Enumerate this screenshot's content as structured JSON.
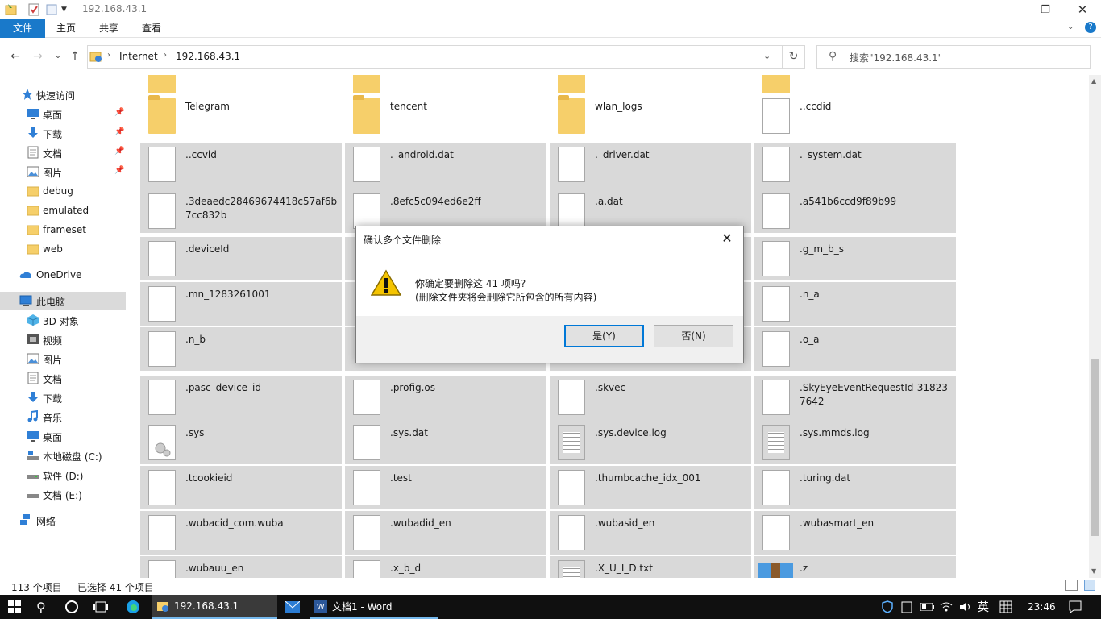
{
  "window": {
    "title": "192.168.43.1"
  },
  "ribbon": {
    "tabs": [
      "文件",
      "主页",
      "共享",
      "查看"
    ]
  },
  "address": {
    "crumbs": [
      "Internet",
      "192.168.43.1"
    ],
    "search_placeholder": "搜索\"192.168.43.1\""
  },
  "nav": {
    "quick_access": "快速访问",
    "items": [
      {
        "label": "桌面",
        "icon": "desktop-icon",
        "pinned": true
      },
      {
        "label": "下载",
        "icon": "download-icon",
        "pinned": true
      },
      {
        "label": "文档",
        "icon": "document-icon",
        "pinned": true
      },
      {
        "label": "图片",
        "icon": "picture-icon",
        "pinned": true
      },
      {
        "label": "debug",
        "icon": "folder-icon",
        "pinned": false
      },
      {
        "label": "emulated",
        "icon": "folder-icon",
        "pinned": false
      },
      {
        "label": "frameset",
        "icon": "folder-icon",
        "pinned": false
      },
      {
        "label": "web",
        "icon": "folder-icon",
        "pinned": false
      }
    ],
    "onedrive": "OneDrive",
    "this_pc": "此电脑",
    "pc_items": [
      {
        "label": "3D 对象",
        "icon": "3d-objects-icon"
      },
      {
        "label": "视频",
        "icon": "video-icon"
      },
      {
        "label": "图片",
        "icon": "picture-icon"
      },
      {
        "label": "文档",
        "icon": "document-icon"
      },
      {
        "label": "下载",
        "icon": "download-icon"
      },
      {
        "label": "音乐",
        "icon": "music-icon"
      },
      {
        "label": "桌面",
        "icon": "desktop-icon"
      },
      {
        "label": "本地磁盘 (C:)",
        "icon": "drive-c-icon"
      },
      {
        "label": "软件 (D:)",
        "icon": "drive-icon"
      },
      {
        "label": "文档 (E:)",
        "icon": "drive-icon"
      }
    ],
    "network": "网络"
  },
  "files": [
    {
      "name": "Telegram",
      "type": "folder",
      "selected": false
    },
    {
      "name": "tencent",
      "type": "folder",
      "selected": false
    },
    {
      "name": "wlan_logs",
      "type": "folder",
      "selected": false
    },
    {
      "name": "..ccdid",
      "type": "file",
      "selected": false
    },
    {
      "name": "..ccvid",
      "type": "file",
      "selected": true
    },
    {
      "name": "._android.dat",
      "type": "file",
      "selected": true
    },
    {
      "name": "._driver.dat",
      "type": "file",
      "selected": true
    },
    {
      "name": "._system.dat",
      "type": "file",
      "selected": true
    },
    {
      "name": ".3deaedc28469674418c57af6b7cc832b",
      "type": "file",
      "selected": true
    },
    {
      "name": ".8efc5c094ed6e2ff",
      "type": "file",
      "selected": true
    },
    {
      "name": ".a.dat",
      "type": "file",
      "selected": true
    },
    {
      "name": ".a541b6ccd9f89b99",
      "type": "file",
      "selected": true
    },
    {
      "name": ".deviceId",
      "type": "file",
      "selected": true
    },
    {
      "name": "",
      "type": "hidden",
      "selected": true
    },
    {
      "name": "",
      "type": "hidden",
      "selected": true
    },
    {
      "name": ".g_m_b_s",
      "type": "file",
      "selected": true
    },
    {
      "name": ".mn_1283261001",
      "type": "file",
      "selected": true
    },
    {
      "name": "",
      "type": "hidden",
      "selected": true
    },
    {
      "name": "",
      "type": "hidden",
      "selected": true
    },
    {
      "name": ".n_a",
      "type": "file",
      "selected": true
    },
    {
      "name": ".n_b",
      "type": "file",
      "selected": true
    },
    {
      "name": "",
      "type": "hidden",
      "selected": true
    },
    {
      "name": "",
      "type": "hidden",
      "selected": true
    },
    {
      "name": ".o_a",
      "type": "file",
      "selected": true
    },
    {
      "name": ".pasc_device_id",
      "type": "file",
      "selected": true
    },
    {
      "name": ".profig.os",
      "type": "file",
      "selected": true
    },
    {
      "name": ".skvec",
      "type": "file",
      "selected": true
    },
    {
      "name": ".SkyEyeEventRequestId-318237642",
      "type": "file",
      "selected": true
    },
    {
      "name": ".sys",
      "type": "settings",
      "selected": true
    },
    {
      "name": ".sys.dat",
      "type": "file",
      "selected": true
    },
    {
      "name": ".sys.device.log",
      "type": "text",
      "selected": true
    },
    {
      "name": ".sys.mmds.log",
      "type": "text",
      "selected": true
    },
    {
      "name": ".tcookieid",
      "type": "file",
      "selected": true
    },
    {
      "name": ".test",
      "type": "file",
      "selected": true
    },
    {
      "name": ".thumbcache_idx_001",
      "type": "file",
      "selected": true
    },
    {
      "name": ".turing.dat",
      "type": "file",
      "selected": true
    },
    {
      "name": ".wubacid_com.wuba",
      "type": "file",
      "selected": true
    },
    {
      "name": ".wubadid_en",
      "type": "file",
      "selected": true
    },
    {
      "name": ".wubasid_en",
      "type": "file",
      "selected": true
    },
    {
      "name": ".wubasmart_en",
      "type": "file",
      "selected": true
    },
    {
      "name": ".wubauu_en",
      "type": "file",
      "selected": true
    },
    {
      "name": ".x_b_d",
      "type": "file",
      "selected": true
    },
    {
      "name": ".X_U_I_D.txt",
      "type": "text",
      "selected": true
    },
    {
      "name": ".z",
      "type": "archive",
      "selected": true
    }
  ],
  "status": {
    "count": "113 个项目",
    "selected": "已选择 41 个项目"
  },
  "dialog": {
    "title": "确认多个文件删除",
    "message": "你确定要删除这 41 项吗?",
    "detail": "(删除文件夹将会删除它所包含的所有内容)",
    "yes": "是(Y)",
    "no": "否(N)"
  },
  "taskbar": {
    "explorer_label": "192.168.43.1",
    "word_label": "文档1 - Word",
    "ime": "英",
    "time": "23:46"
  }
}
